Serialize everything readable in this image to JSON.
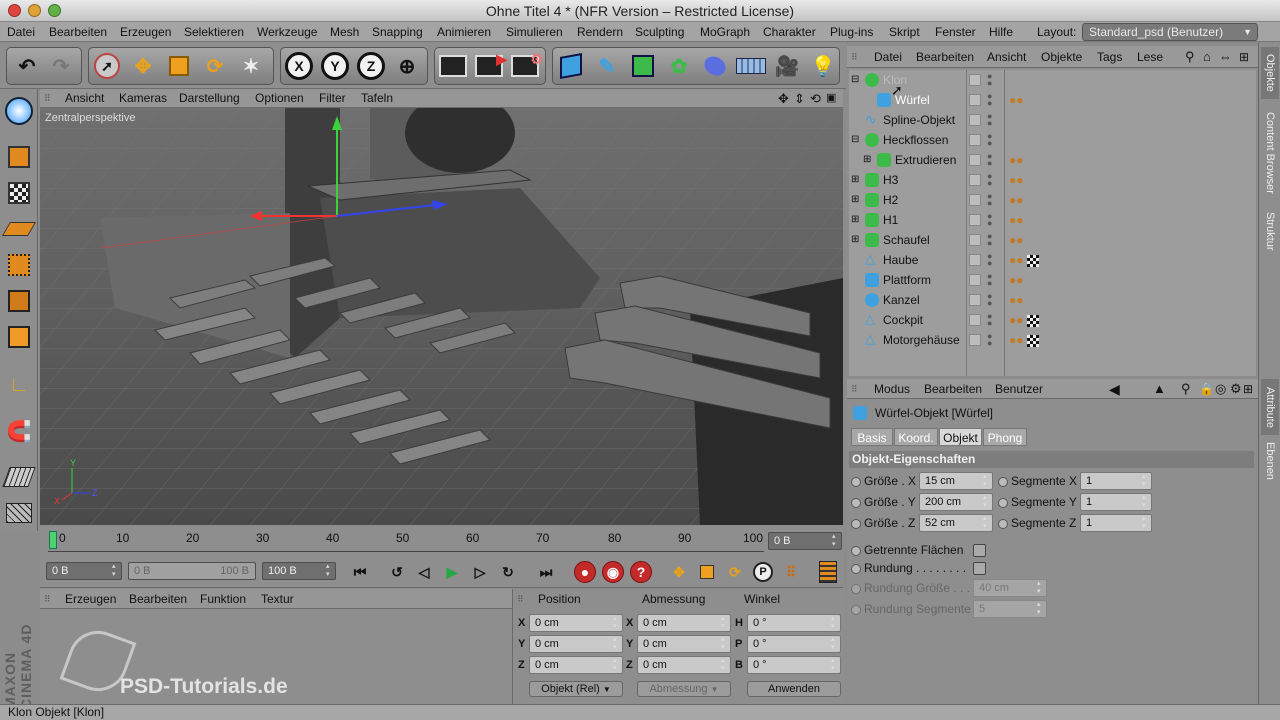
{
  "window": {
    "title": "Ohne Titel 4 * (NFR Version – Restricted License)"
  },
  "menubar": {
    "items": [
      "Datei",
      "Bearbeiten",
      "Erzeugen",
      "Selektieren",
      "Werkzeuge",
      "Mesh",
      "Snapping",
      "Animieren",
      "Simulieren",
      "Rendern",
      "Sculpting",
      "MoGraph",
      "Charakter",
      "Plug-ins",
      "Skript",
      "Fenster",
      "Hilfe"
    ],
    "layout_label": "Layout:",
    "layout_value": "Standard_psd (Benutzer)"
  },
  "viewport": {
    "menu": [
      "Ansicht",
      "Kameras",
      "Darstellung",
      "Optionen",
      "Filter",
      "Tafeln"
    ],
    "label": "Zentralperspektive"
  },
  "timeline": {
    "ticks": [
      "0",
      "10",
      "20",
      "30",
      "40",
      "50",
      "60",
      "70",
      "80",
      "90",
      "100"
    ],
    "current_frame": "0 B"
  },
  "playback": {
    "start": "0 B",
    "range_start": "0 B",
    "range_end": "100 B",
    "end": "100 B"
  },
  "material_panel": {
    "menu": [
      "Erzeugen",
      "Bearbeiten",
      "Funktion",
      "Textur"
    ]
  },
  "watermark": {
    "brand": "MAXON CINEMA 4D",
    "site": "PSD-Tutorials.de"
  },
  "coords": {
    "headers": [
      "Position",
      "Abmessung",
      "Winkel"
    ],
    "rows": [
      {
        "pos_label": "X",
        "pos": "0 cm",
        "size_label": "X",
        "size": "0 cm",
        "rot_label": "H",
        "rot": "0 °"
      },
      {
        "pos_label": "Y",
        "pos": "0 cm",
        "size_label": "Y",
        "size": "0 cm",
        "rot_label": "P",
        "rot": "0 °"
      },
      {
        "pos_label": "Z",
        "pos": "0 cm",
        "size_label": "Z",
        "size": "0 cm",
        "rot_label": "B",
        "rot": "0 °"
      }
    ],
    "mode_select": "Objekt (Rel)",
    "size_select": "Abmessung",
    "apply_button": "Anwenden"
  },
  "object_manager": {
    "menu": [
      "Datei",
      "Bearbeiten",
      "Ansicht",
      "Objekte",
      "Tags",
      "Lese"
    ],
    "objects": [
      {
        "name": "Klon",
        "icon": "cloner-icon",
        "expanded": true,
        "greyed": true,
        "tags": ""
      },
      {
        "name": "Würfel",
        "icon": "cube-icon",
        "child": true,
        "tags": "material-tags"
      },
      {
        "name": "Spline-Objekt",
        "icon": "spline-icon",
        "tags": ""
      },
      {
        "name": "Heckflossen",
        "icon": "null-icon",
        "expanded": true,
        "tags": ""
      },
      {
        "name": "Extrudieren",
        "icon": "extrude-icon",
        "child": true,
        "tags": "material-tags"
      },
      {
        "name": "H3",
        "icon": "extrude-icon",
        "tags": "material-tags"
      },
      {
        "name": "H2",
        "icon": "extrude-icon",
        "tags": "material-tags"
      },
      {
        "name": "H1",
        "icon": "extrude-icon",
        "tags": "material-tags"
      },
      {
        "name": "Schaufel",
        "icon": "extrude-icon",
        "tags": "material-tags"
      },
      {
        "name": "Haube",
        "icon": "cone-icon",
        "tags": "material-checker-tags"
      },
      {
        "name": "Plattform",
        "icon": "cube-icon",
        "tags": "material-tags"
      },
      {
        "name": "Kanzel",
        "icon": "sphere-icon",
        "tags": "material-tags"
      },
      {
        "name": "Cockpit",
        "icon": "cone-icon",
        "tags": "material-checker-tags"
      },
      {
        "name": "Motorgehäuse",
        "icon": "cone-icon",
        "tags": "material-checker-tags"
      }
    ]
  },
  "attributes": {
    "menu": [
      "Modus",
      "Bearbeiten",
      "Benutzer"
    ],
    "object_title": "Würfel-Objekt [Würfel]",
    "tabs": [
      "Basis",
      "Koord.",
      "Objekt",
      "Phong"
    ],
    "active_tab": "Objekt",
    "section": "Objekt-Eigenschaften",
    "size_x_label": "Größe . X",
    "size_x": "15 cm",
    "size_y_label": "Größe . Y",
    "size_y": "200 cm",
    "size_z_label": "Größe . Z",
    "size_z": "52 cm",
    "seg_x_label": "Segmente X",
    "seg_x": "1",
    "seg_y_label": "Segmente Y",
    "seg_y": "1",
    "seg_z_label": "Segmente Z",
    "seg_z": "1",
    "separate_faces": "Getrennte Flächen",
    "fillet": "Rundung . . . . . . . .",
    "fillet_size_label": "Rundung Größe . . .",
    "fillet_size": "40 cm",
    "fillet_seg_label": "Rundung Segmente",
    "fillet_seg": "5"
  },
  "side_tabs": [
    "Objekte",
    "Content Browser",
    "Struktur",
    "Attribute",
    "Ebenen"
  ],
  "status": "Klon Objekt [Klon]"
}
